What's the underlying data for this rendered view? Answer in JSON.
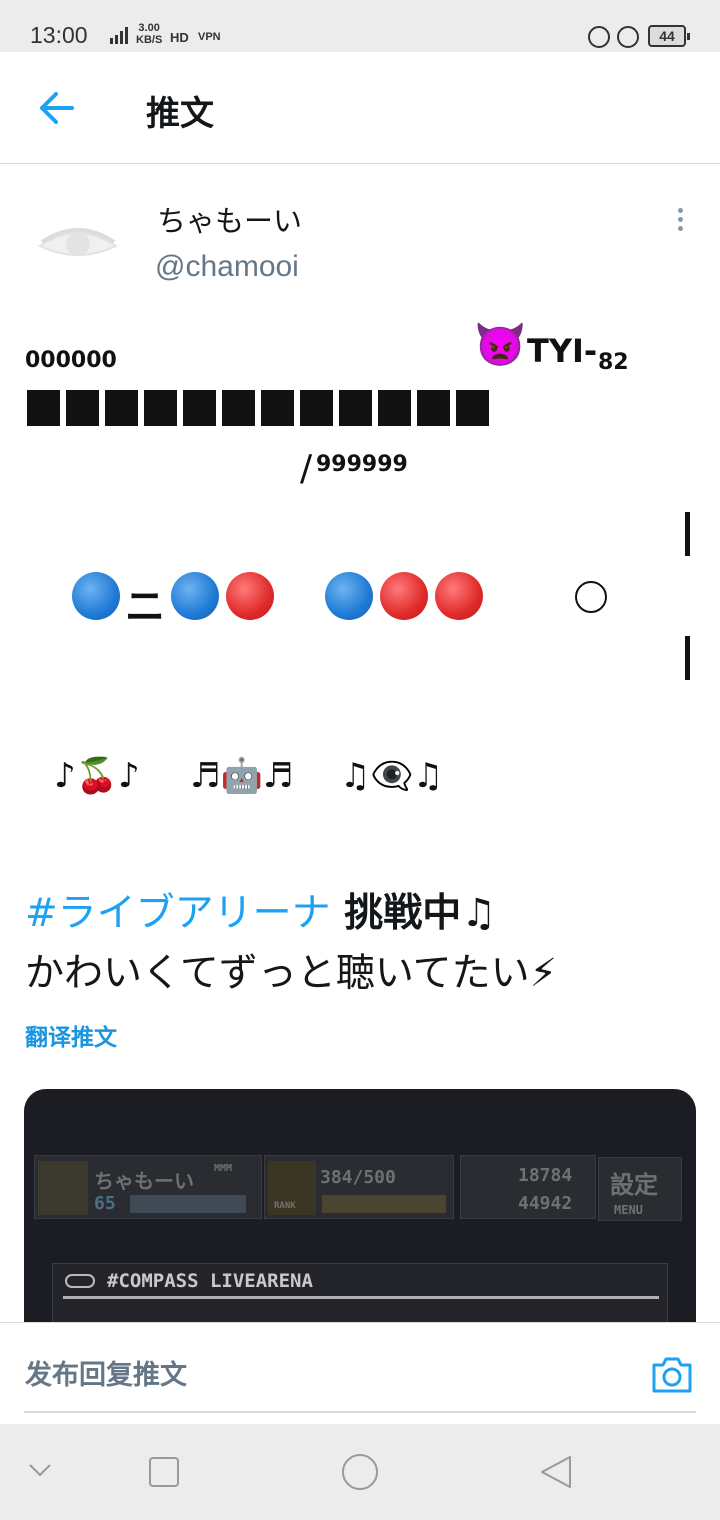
{
  "status_bar": {
    "time": "13:00",
    "network_speed": "3.00",
    "network_speed_unit": "KB/S",
    "hd_label": "HD",
    "vpn_label": "VPN",
    "battery": "44"
  },
  "header": {
    "title": "推文"
  },
  "author": {
    "display_name": "ちゃもーい",
    "handle": "@chamooi"
  },
  "art": {
    "zeros": "000000",
    "tyi": "TYI-",
    "subscript": "82",
    "slash": "/",
    "nines": "999999",
    "ni": "ニ",
    "music_1": "♪🍒♪",
    "music_2": "♬🤖♬",
    "music_3": "♫👁️‍🗨️♫"
  },
  "tweet": {
    "hashtag": "#ライブアリーナ",
    "line1_rest": " 挑戦中♫",
    "line2": "かわいくてずっと聴いてたい⚡",
    "translate_label": "翻译推文"
  },
  "media": {
    "player_name": "ちゃもーい",
    "player_name_suffix": "MMM",
    "level": "65",
    "rank_progress": "384/500",
    "rank_label": "RANK",
    "stat_1": "18784",
    "stat_2": "44942",
    "settings_label": "設定",
    "menu_label": "MENU",
    "banner_text": "#COMPASS LIVEARENA"
  },
  "reply": {
    "placeholder": "发布回复推文"
  },
  "colors": {
    "accent": "#1da1f2",
    "secondary_text": "#657786"
  }
}
